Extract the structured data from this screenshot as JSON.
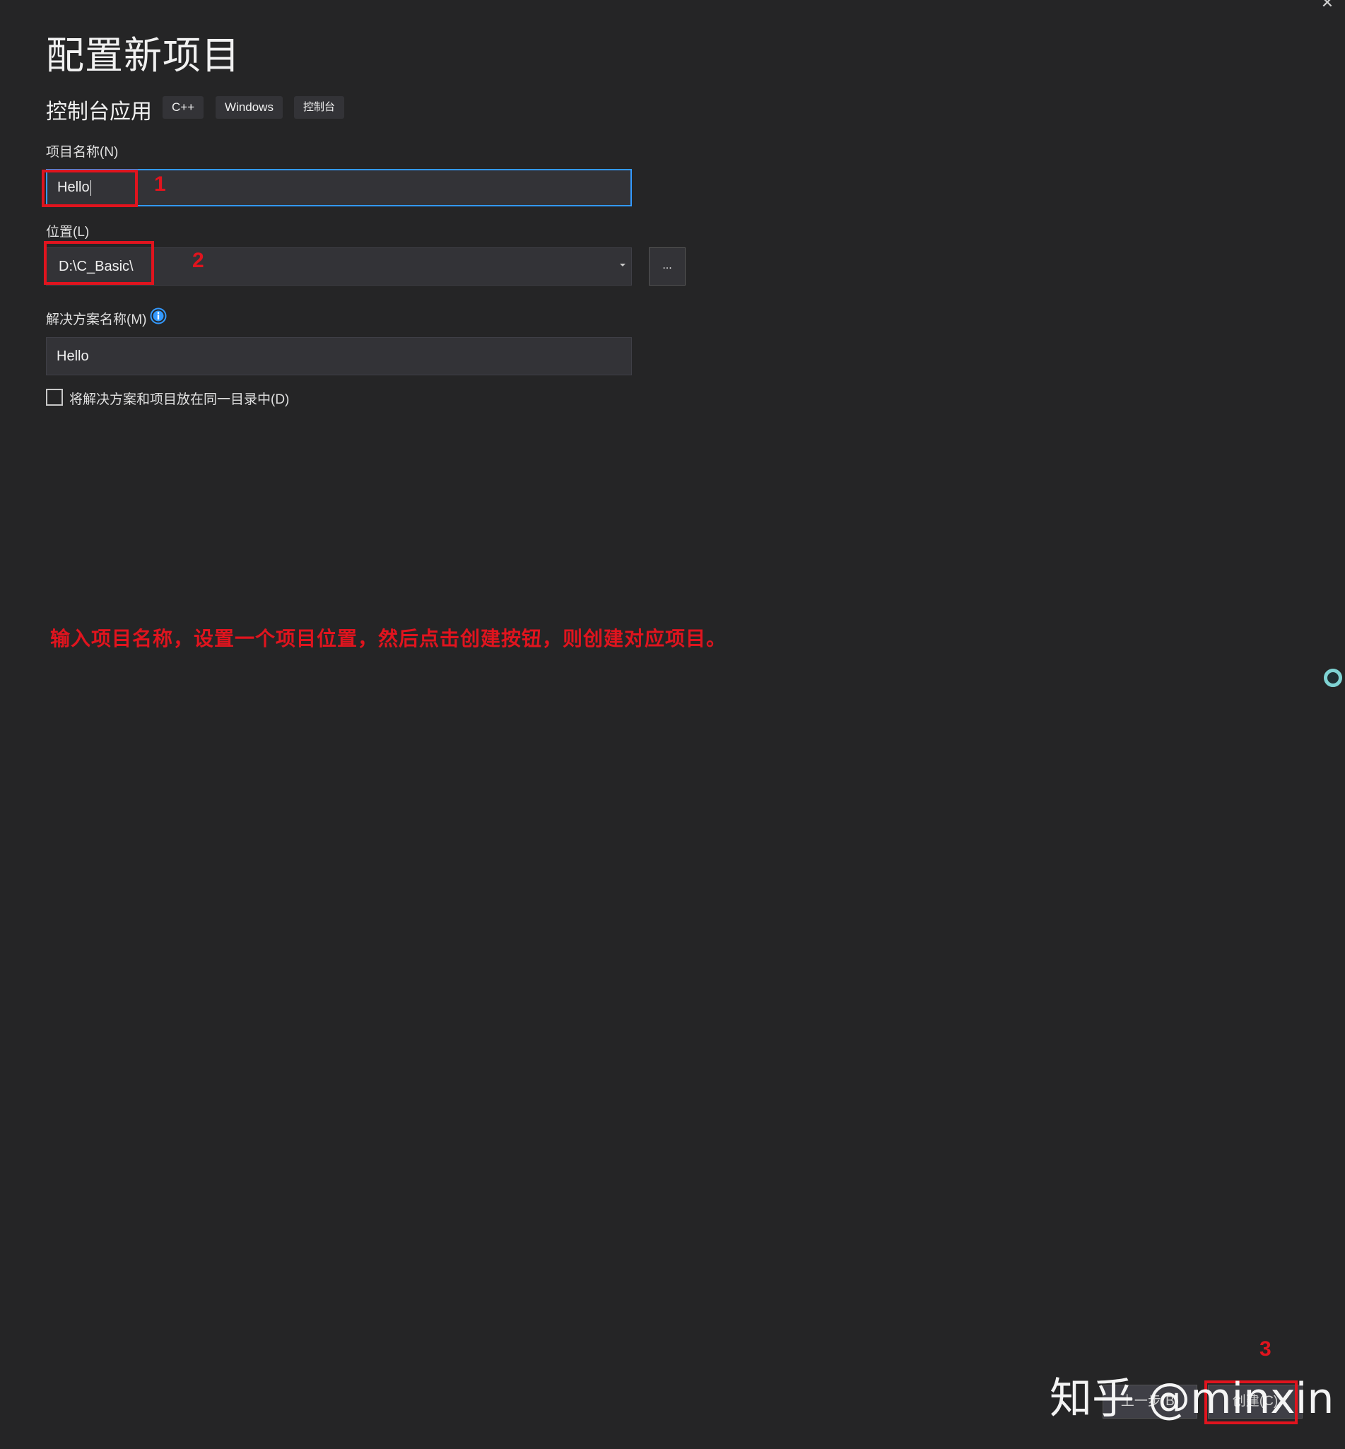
{
  "window": {
    "close_glyph": "✕"
  },
  "page_title": "配置新项目",
  "template": {
    "name": "控制台应用",
    "tags": [
      "C++",
      "Windows",
      "控制台"
    ]
  },
  "project_name": {
    "label": "项目名称(N)",
    "value": "Hello"
  },
  "location": {
    "label": "位置(L)",
    "value": "D:\\C_Basic\\",
    "browse_label": "..."
  },
  "solution_name": {
    "label": "解决方案名称(M)",
    "value": "Hello"
  },
  "same_directory": {
    "label": "将解决方案和项目放在同一目录中(D)",
    "checked": false
  },
  "annotations": {
    "step1": "1",
    "step2": "2",
    "step3": "3",
    "instruction": "输入项目名称，设置一个项目位置，然后点击创建按钮，则创建对应项目。",
    "color": "#e0141e"
  },
  "footer": {
    "back_label": "上一步(B)",
    "create_label": "创建(C)"
  },
  "watermark": "知乎 @minxin",
  "colors": {
    "background": "#252526",
    "input_bg": "#333337",
    "focus_border": "#3399ff",
    "info_icon": "#3399ff"
  }
}
